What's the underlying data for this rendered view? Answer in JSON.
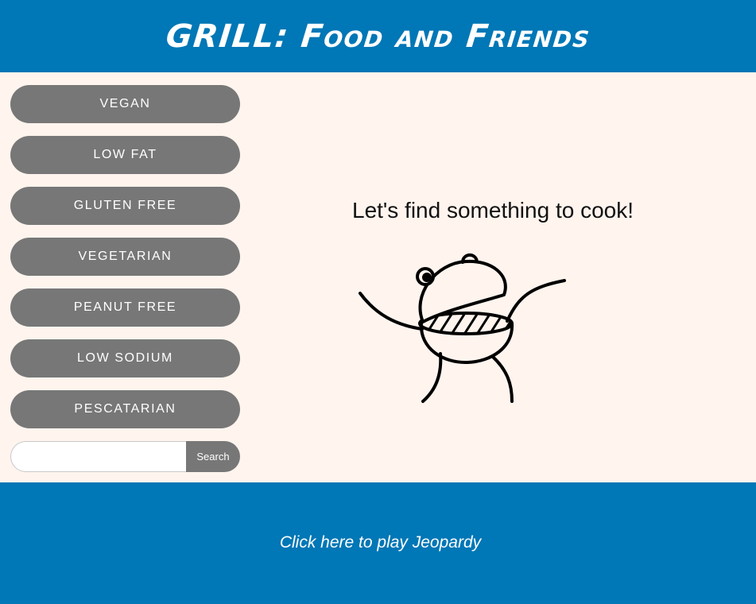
{
  "header": {
    "title": "GRILL: Food and Friends"
  },
  "sidebar": {
    "filters": [
      {
        "label": "VEGAN"
      },
      {
        "label": "LOW FAT"
      },
      {
        "label": "GLUTEN FREE"
      },
      {
        "label": "VEGETARIAN"
      },
      {
        "label": "PEANUT FREE"
      },
      {
        "label": "LOW SODIUM"
      },
      {
        "label": "PESCATARIAN"
      }
    ],
    "search": {
      "value": "",
      "placeholder": "",
      "button_label": "Search"
    }
  },
  "main": {
    "tagline": "Let's find something to cook!",
    "illustration": "grill-character-illustration"
  },
  "footer": {
    "link_text": "Click here to play Jeopardy"
  },
  "colors": {
    "brand_blue": "#0077b6",
    "background": "#fff4ee",
    "button_gray": "#777777",
    "text_white": "#ffffff"
  }
}
